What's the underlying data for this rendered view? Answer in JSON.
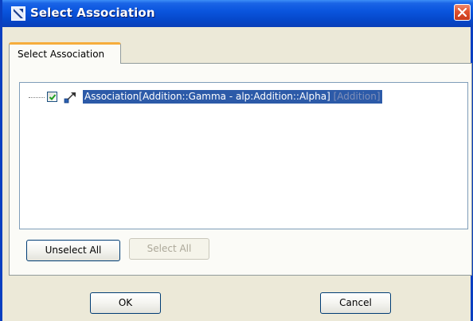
{
  "window": {
    "title": "Select Association"
  },
  "tabs": [
    {
      "label": "Select Association"
    }
  ],
  "tree": {
    "items": [
      {
        "checked": true,
        "label": "Association[Addition::Gamma - alp:Addition::Alpha]",
        "qualifier": "[Addition]"
      }
    ]
  },
  "buttons": {
    "unselect_all": "Unselect All",
    "select_all": "Select All",
    "ok": "OK",
    "cancel": "Cancel"
  },
  "icons": {
    "title": "dialog-icon",
    "close": "close-icon",
    "checkbox": "checkmark-icon",
    "association": "association-icon"
  },
  "colors": {
    "titlebar": "#0a55de",
    "selection": "#2c5aa8",
    "tab_highlight": "#f6ad3c",
    "close": "#e0512d"
  }
}
